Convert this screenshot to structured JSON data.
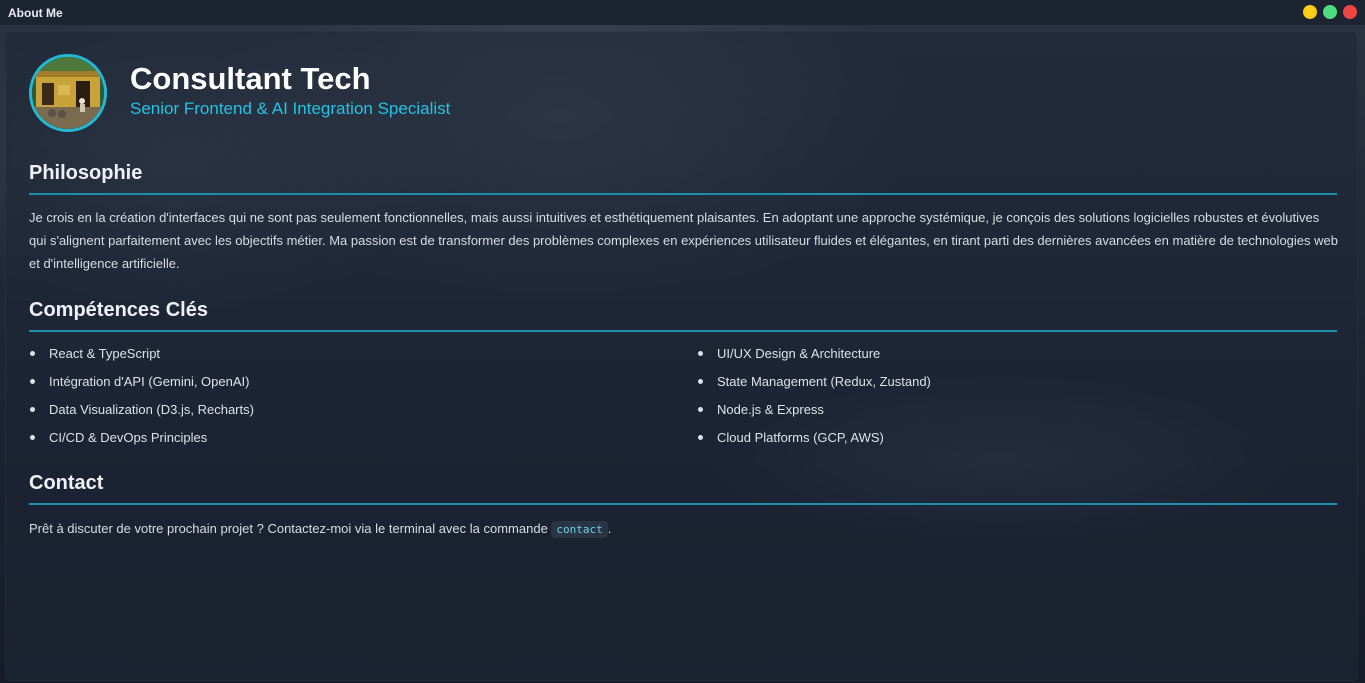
{
  "window": {
    "title": "About Me",
    "controls": [
      "minimize",
      "maximize",
      "close"
    ]
  },
  "profile": {
    "name": "Consultant Tech",
    "subtitle": "Senior Frontend & AI Integration Specialist",
    "avatar_icon": "profile-photo"
  },
  "philosophy": {
    "heading": "Philosophie",
    "text": "Je crois en la création d'interfaces qui ne sont pas seulement fonctionnelles, mais aussi intuitives et esthétiquement plaisantes. En adoptant une approche systémique, je conçois des solutions logicielles robustes et évolutives qui s'alignent parfaitement avec les objectifs métier. Ma passion est de transformer des problèmes complexes en expériences utilisateur fluides et élégantes, en tirant parti des dernières avancées en matière de technologies web et d'intelligence artificielle."
  },
  "skills": {
    "heading": "Compétences Clés",
    "items": [
      "React & TypeScript",
      "UI/UX Design & Architecture",
      "Intégration d'API (Gemini, OpenAI)",
      "State Management (Redux, Zustand)",
      "Data Visualization (D3.js, Recharts)",
      "Node.js & Express",
      "CI/CD & DevOps Principles",
      "Cloud Platforms (GCP, AWS)"
    ]
  },
  "contact": {
    "heading": "Contact",
    "text_before": "Prêt à discuter de votre prochain projet ? Contactez-moi via le terminal avec la commande ",
    "command": "contact",
    "text_after": "."
  },
  "colors": {
    "accent": "#22c3e6",
    "rule": "#1b8fae",
    "background": "#1a2130",
    "minimize": "#facc15",
    "maximize": "#4ade80",
    "close": "#ef4444"
  }
}
